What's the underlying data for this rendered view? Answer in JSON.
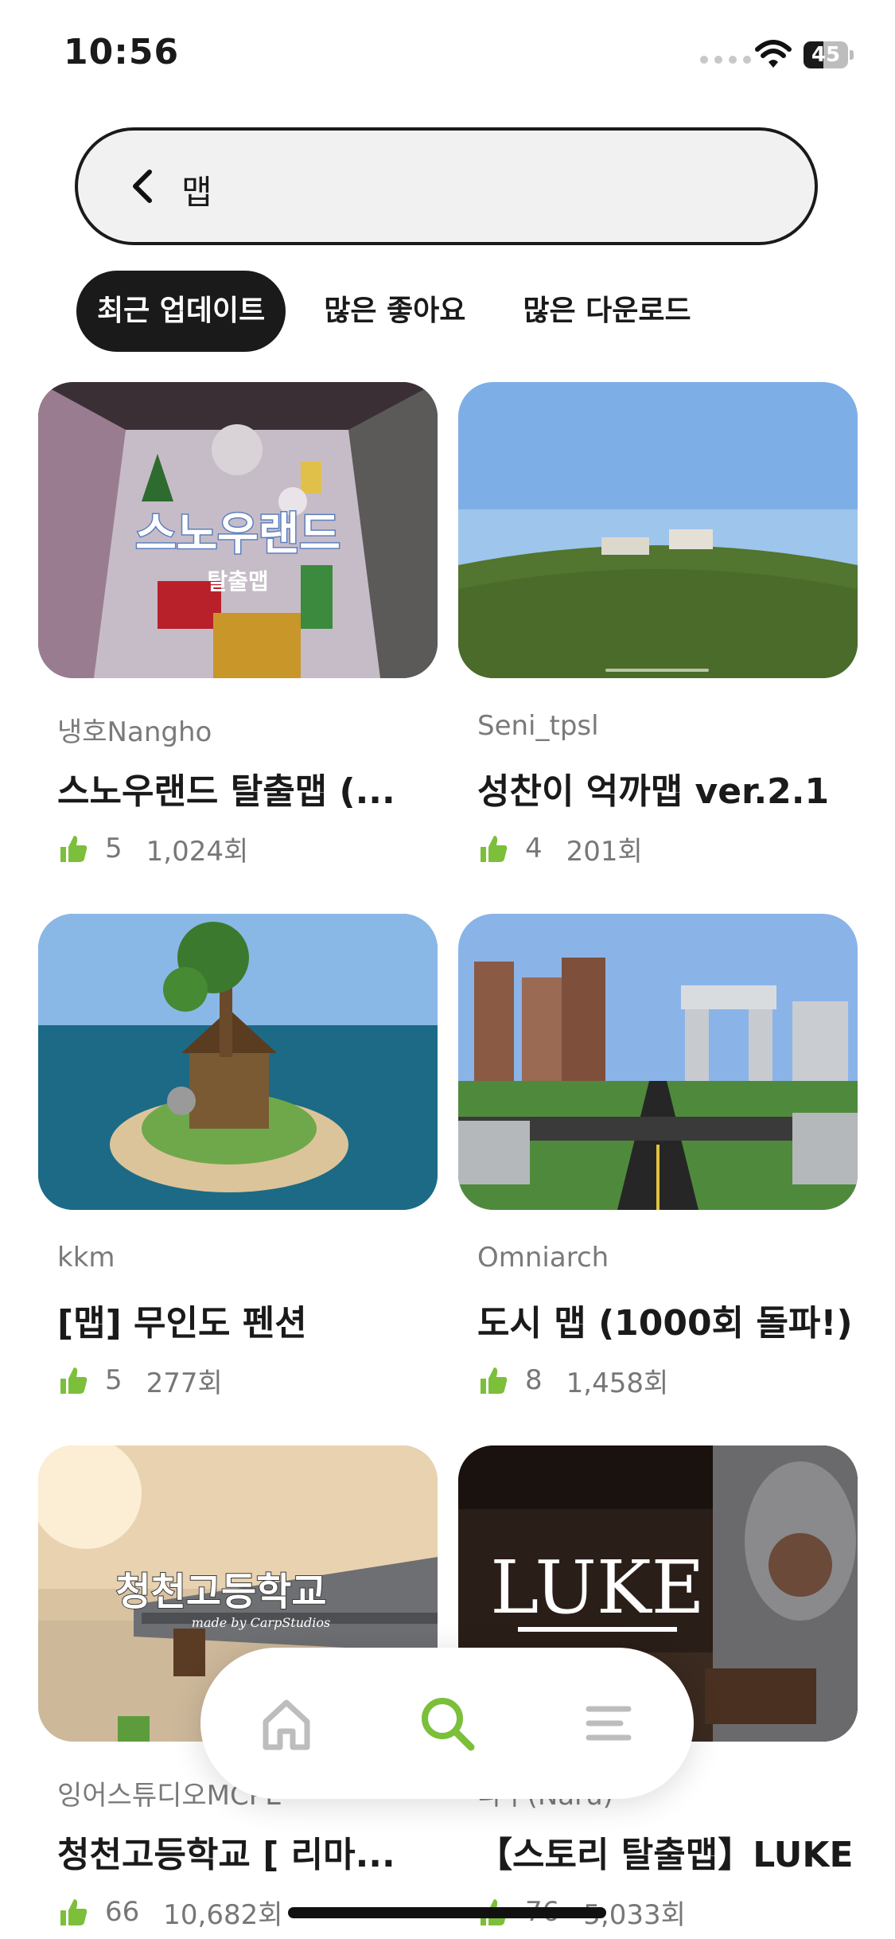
{
  "status_bar": {
    "time": "10:56",
    "battery_percent": "45",
    "battery_level": 0.45
  },
  "search": {
    "query": "맵",
    "back_icon": "chevron-left-icon"
  },
  "tabs": [
    {
      "label": "최근 업데이트",
      "active": true
    },
    {
      "label": "많은 좋아요",
      "active": false
    },
    {
      "label": "많은 다운로드",
      "active": false
    }
  ],
  "cards": [
    {
      "author": "냉호Nangho",
      "title": "스노우랜드 탈출맵 (...",
      "likes": "5",
      "downloads": "1,024회",
      "thumb_overlay": "스노우랜드",
      "thumb_sub": "탈출맵"
    },
    {
      "author": "Seni_tpsl",
      "title": "성찬이 억까맵 ver.2.1",
      "likes": "4",
      "downloads": "201회"
    },
    {
      "author": "kkm",
      "title": "[맵] 무인도 펜션",
      "likes": "5",
      "downloads": "277회"
    },
    {
      "author": "Omniarch",
      "title": "도시 맵 (1000회 돌파!)",
      "likes": "8",
      "downloads": "1,458회"
    },
    {
      "author": "잉어스튜디오MCPE",
      "title": "청천고등학교 [ 리마...",
      "likes": "66",
      "downloads": "10,682회",
      "thumb_overlay": "청천고등학교",
      "thumb_sub": "made by CarpStudios"
    },
    {
      "author": "나루(Naru)",
      "title": "【스토리 탈출맵】LUKE",
      "likes": "76",
      "downloads": "5,033회",
      "thumb_overlay": "LUKE"
    }
  ],
  "bottom_nav": [
    {
      "icon": "home-icon",
      "active": false
    },
    {
      "icon": "search-icon",
      "active": true
    },
    {
      "icon": "menu-icon",
      "active": false
    }
  ],
  "colors": {
    "accent_green": "#7cbf3a",
    "dark": "#1a1a1a",
    "muted": "#7a7a7a"
  }
}
